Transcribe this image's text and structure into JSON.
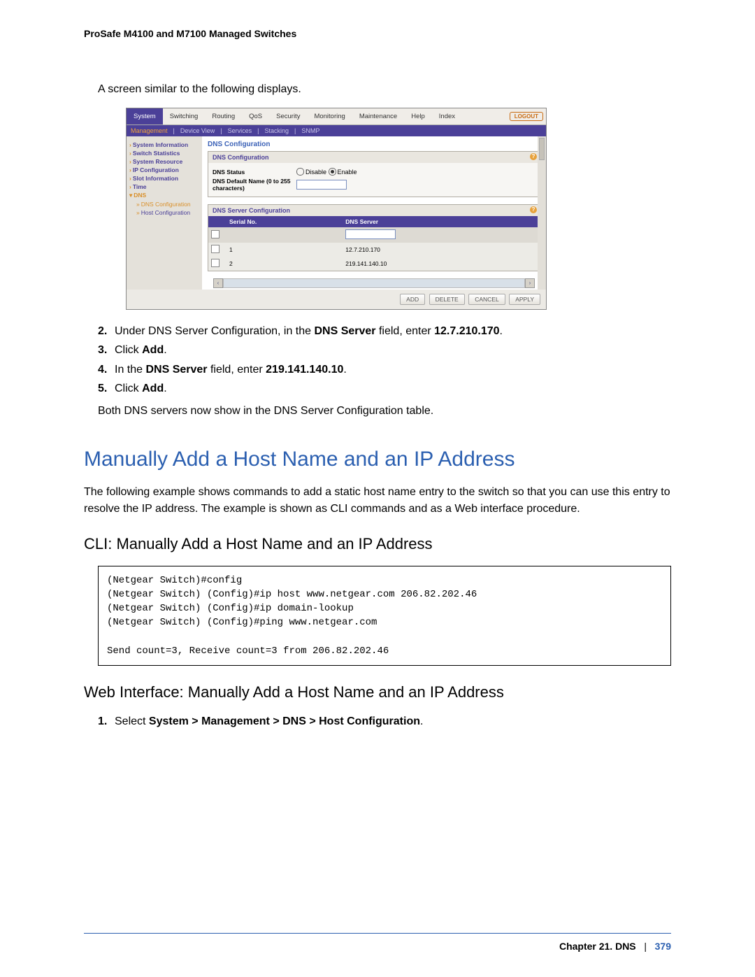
{
  "header": "ProSafe M4100 and M7100 Managed Switches",
  "intro": "A screen similar to the following displays.",
  "ui": {
    "tabs": [
      "System",
      "Switching",
      "Routing",
      "QoS",
      "Security",
      "Monitoring",
      "Maintenance",
      "Help",
      "Index"
    ],
    "logout": "LOGOUT",
    "subtabs": [
      "Management",
      "Device View",
      "Services",
      "Stacking",
      "SNMP"
    ],
    "sidebar": {
      "items": [
        {
          "label": "System Information",
          "bold": true
        },
        {
          "label": "Switch Statistics",
          "bold": true
        },
        {
          "label": "System Resource",
          "bold": true
        },
        {
          "label": "IP Configuration",
          "bold": true
        },
        {
          "label": "Slot Information",
          "bold": true
        },
        {
          "label": "Time",
          "bold": true
        },
        {
          "label": "DNS",
          "bold": true,
          "expanded": true
        },
        {
          "label": "DNS Configuration",
          "sub": true,
          "active": true
        },
        {
          "label": "Host Configuration",
          "sub": true
        }
      ]
    },
    "panel_title": "DNS Configuration",
    "dns_config": {
      "title": "DNS Configuration",
      "dns_status_label": "DNS Status",
      "opt_disable": "Disable",
      "opt_enable": "Enable",
      "default_name_label": "DNS Default Name (0 to 255 characters)"
    },
    "dns_server": {
      "title": "DNS Server Configuration",
      "col_serial": "Serial No.",
      "col_server": "DNS Server",
      "rows": [
        {
          "serial": "1",
          "server": "12.7.210.170"
        },
        {
          "serial": "2",
          "server": "219.141.140.10"
        }
      ]
    },
    "buttons": [
      "ADD",
      "DELETE",
      "CANCEL",
      "APPLY"
    ]
  },
  "steps1": {
    "s2_a": "Under DNS Server Configuration, in the ",
    "s2_b": "DNS Server",
    "s2_c": " field, enter ",
    "s2_d": "12.7.210.170",
    "s2_e": ".",
    "s3_a": "Click ",
    "s3_b": "Add",
    "s3_c": ".",
    "s4_a": "In the ",
    "s4_b": "DNS Server",
    "s4_c": " field, enter ",
    "s4_d": "219.141.140.10",
    "s4_e": ".",
    "s5_a": "Click ",
    "s5_b": "Add",
    "s5_c": "."
  },
  "para1": "Both DNS servers now show in the DNS Server Configuration table.",
  "h1": "Manually Add a Host Name and an IP Address",
  "para2": "The following example shows commands to add a static host name entry to the switch so that you can use this entry to resolve the IP address. The example is shown as CLI commands and as a Web interface procedure.",
  "h2a": "CLI: Manually Add a Host Name and an IP Address",
  "cli": "(Netgear Switch)#config\n(Netgear Switch) (Config)#ip host www.netgear.com 206.82.202.46\n(Netgear Switch) (Config)#ip domain-lookup\n(Netgear Switch) (Config)#ping www.netgear.com\n\nSend count=3, Receive count=3 from 206.82.202.46",
  "h2b": "Web Interface: Manually Add a Host Name and an IP Address",
  "step_web1_a": "Select ",
  "step_web1_b": "System > Management > DNS > Host Configuration",
  "step_web1_c": ".",
  "footer": {
    "chapter": "Chapter 21.  DNS",
    "sep": "|",
    "page": "379"
  }
}
